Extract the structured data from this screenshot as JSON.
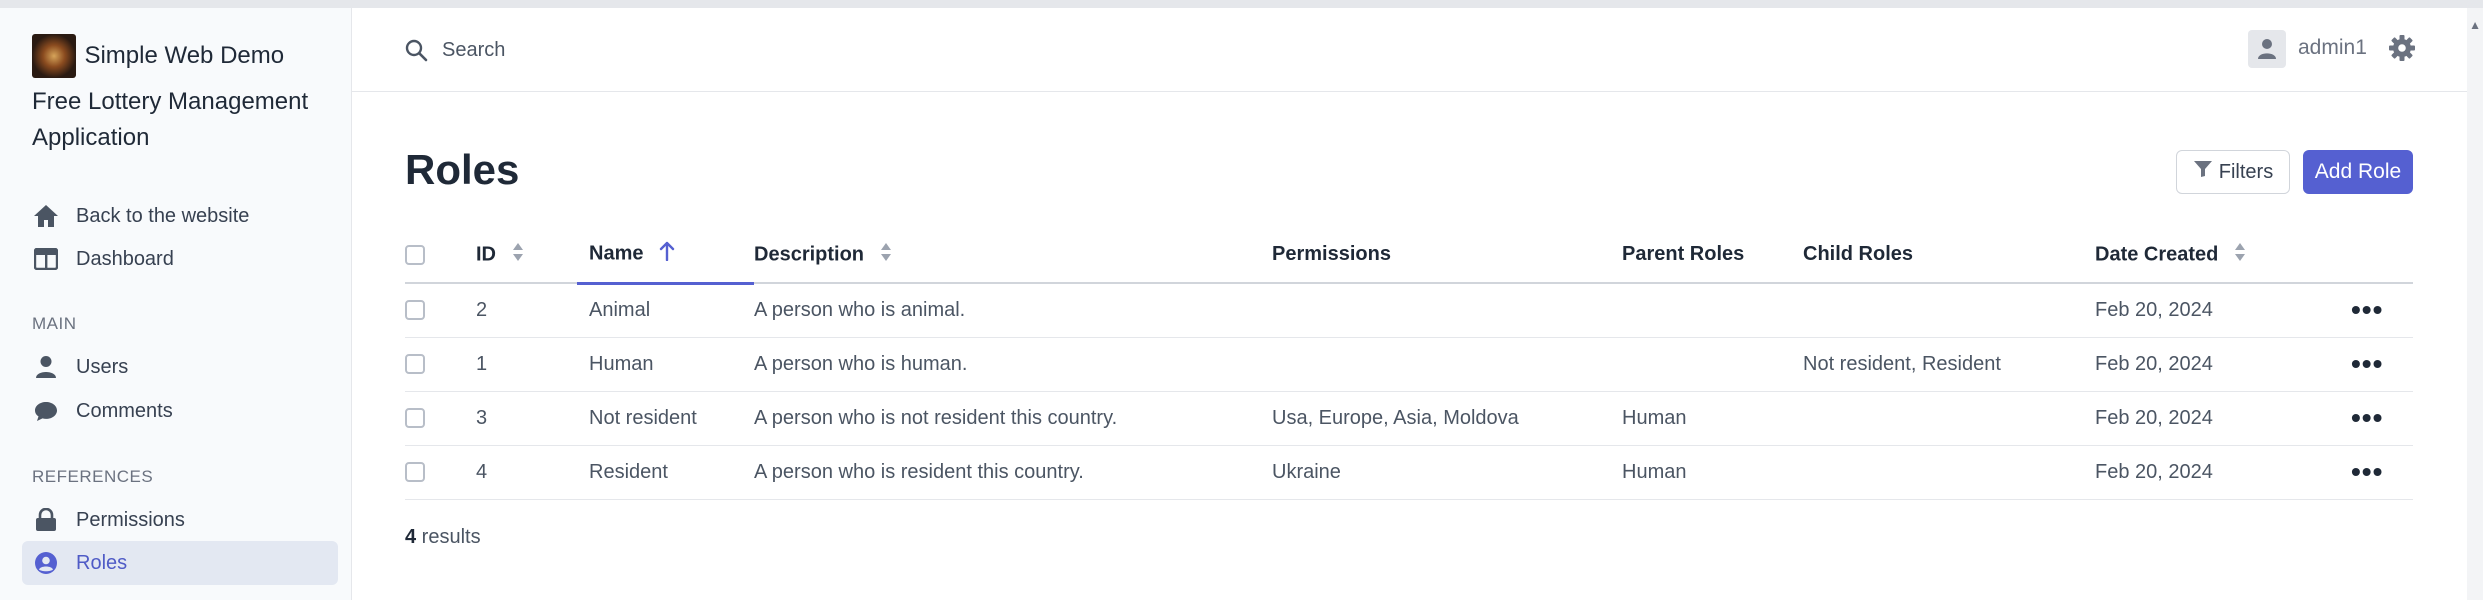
{
  "sidebar": {
    "brand_line1": "Simple Web Demo",
    "brand_line2": "Free Lottery Management Application",
    "nav_top": [
      {
        "label": "Back to the website",
        "icon": "home-icon"
      },
      {
        "label": "Dashboard",
        "icon": "dashboard-icon"
      }
    ],
    "section_main": "MAIN",
    "nav_main": [
      {
        "label": "Users",
        "icon": "user-icon"
      },
      {
        "label": "Comments",
        "icon": "comment-icon"
      }
    ],
    "section_references": "REFERENCES",
    "nav_references": [
      {
        "label": "Permissions",
        "icon": "lock-icon"
      },
      {
        "label": "Roles",
        "icon": "user-circle-icon",
        "active": true
      }
    ]
  },
  "header": {
    "search_placeholder": "Search",
    "username": "admin1"
  },
  "main": {
    "title": "Roles",
    "filters_label": "Filters",
    "add_label": "Add Role",
    "columns": {
      "id": "ID",
      "name": "Name",
      "description": "Description",
      "permissions": "Permissions",
      "parent_roles": "Parent Roles",
      "child_roles": "Child Roles",
      "date_created": "Date Created"
    },
    "sorted_column": "name",
    "rows": [
      {
        "id": "2",
        "name": "Animal",
        "description": "A person who is animal.",
        "permissions": "",
        "parent_roles": "",
        "child_roles": "",
        "date_created": "Feb 20, 2024",
        "menu": "•••"
      },
      {
        "id": "1",
        "name": "Human",
        "description": "A person who is human.",
        "permissions": "",
        "parent_roles": "",
        "child_roles": "Not resident, Resident",
        "date_created": "Feb 20, 2024",
        "menu": "•••"
      },
      {
        "id": "3",
        "name": "Not resident",
        "description": "A person who is not resident this country.",
        "permissions": "Usa, Europe, Asia, Moldova",
        "parent_roles": "Human",
        "child_roles": "",
        "date_created": "Feb 20, 2024",
        "menu": "•••"
      },
      {
        "id": "4",
        "name": "Resident",
        "description": "A person who is resident this country.",
        "permissions": "Ukraine",
        "parent_roles": "Human",
        "child_roles": "",
        "date_created": "Feb 20, 2024",
        "menu": "•••"
      }
    ],
    "results_count": "4",
    "results_label": " results"
  },
  "colors": {
    "accent": "#5560d1",
    "sidebar_bg": "#f8fafc",
    "active_bg": "#e3e8f2"
  }
}
